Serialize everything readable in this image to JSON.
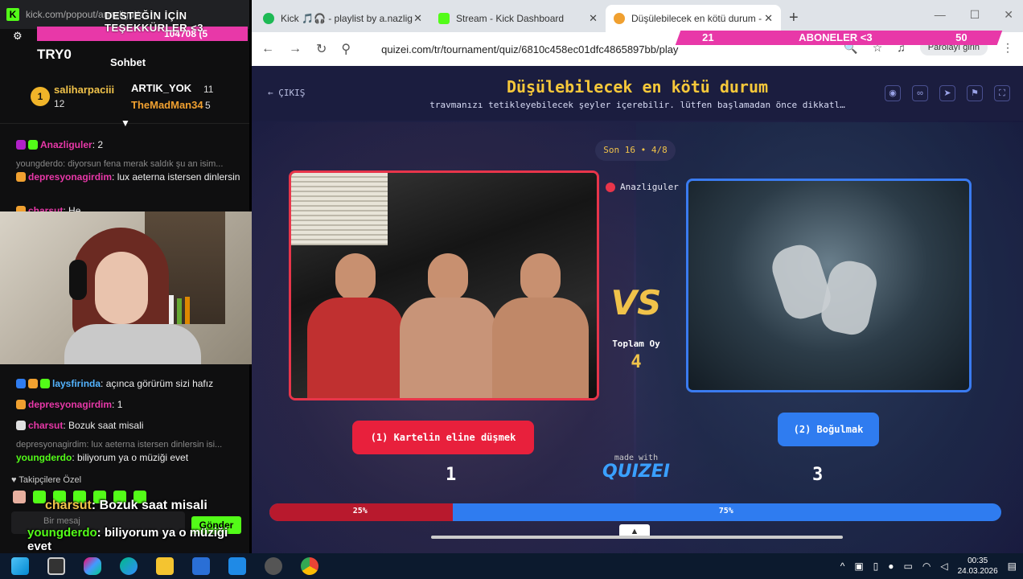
{
  "chat_panel": {
    "popout_url": "kick.com/popout/anazligul/c",
    "goal_banner": "DESTEĞİN İÇİN TEŞEKKÜRLER <3",
    "goal_value": "104708 (5",
    "channel_name": "TRY0",
    "chat_title": "Sohbet",
    "leaderboard": {
      "first": {
        "rank": "1",
        "name": "saliharpaciii",
        "count": "12"
      },
      "second": {
        "name": "ARTIK_YOK",
        "count": "11"
      },
      "third": {
        "name": "TheMadMan34",
        "count": "5"
      }
    },
    "messages_top": [
      {
        "user": "Anazliguler",
        "text": ": 2",
        "color": "#e838a8"
      },
      {
        "reply": "youngderdo: diyorsun fena merak saldık şu an isim...",
        "user": "depresyonagirdim",
        "text": ": lux aeterna istersen dinlersin",
        "color": "#e838a8"
      },
      {
        "user": "charsut",
        "text": ": He",
        "color": "#e838a8"
      }
    ],
    "messages_bottom": [
      {
        "user": "laysfirinda",
        "text": ": açınca görürüm sizi hafız",
        "color": "#53b4ff"
      },
      {
        "user": "depresyonagirdim",
        "text": ": 1",
        "color": "#e838a8"
      },
      {
        "user": "charsut",
        "text": ": Bozuk saat misali",
        "color": "#e838a8"
      },
      {
        "reply": "depresyonagirdim: lux aeterna istersen dinlersin isi...",
        "user": "youngderdo",
        "text": ": biliyorum ya o müziği evet",
        "color": "#53fc18"
      }
    ],
    "follower_note": "Takipçilere Özel",
    "input_placeholder": "Bir mesaj",
    "send_label": "Gönder",
    "overlay_1_user": "charsut",
    "overlay_1_text": ": Bozuk saat misali",
    "overlay_2_user": "youngderdo",
    "overlay_2_text": ": biliyorum ya o müziği evet"
  },
  "browser": {
    "tabs": [
      {
        "label": "Kick 🎵🎧 - playlist by a.nazlig",
        "icon_color": "#1db954"
      },
      {
        "label": "Stream - Kick Dashboard",
        "icon_color": "#53fc18"
      },
      {
        "label": "Düşülebilecek en kötü durum -",
        "icon_color": "#f0a030",
        "active": true
      }
    ],
    "url": "quizei.com/tr/tournament/quiz/6810c458ec01dfc4865897bb/play",
    "password_button": "Parolayı girin",
    "sub_goal": {
      "left": "21",
      "label": "ABONELER <3",
      "right": "50"
    }
  },
  "quiz": {
    "back_label": "ÇIKIŞ",
    "title": "Düşülebilecek en kötü durum",
    "subtitle": "travmanızı tetikleyebilecek şeyler içerebilir. lütfen başlamadan önce dikkatl…",
    "round": "Son 16 • 4/8",
    "voter_name": "Anazliguler",
    "vs_text": "VS",
    "total_label": "Toplam Oy",
    "total_value": "4",
    "option_left": {
      "label": "(1) Kartelin eline düşmek",
      "votes": "1"
    },
    "option_right": {
      "label": "(2) Boğulmak",
      "votes": "3"
    },
    "made_with": "made with",
    "brand": "QUIZEI",
    "result": {
      "left_percent": 25,
      "right_percent": 75,
      "left_label": "25%",
      "right_label": "75%"
    },
    "colors": {
      "left": "#e8203c",
      "right": "#2f7cf0",
      "accent": "#f0c24a"
    }
  },
  "taskbar": {
    "time": "00:35",
    "date": "24.03.2026"
  }
}
